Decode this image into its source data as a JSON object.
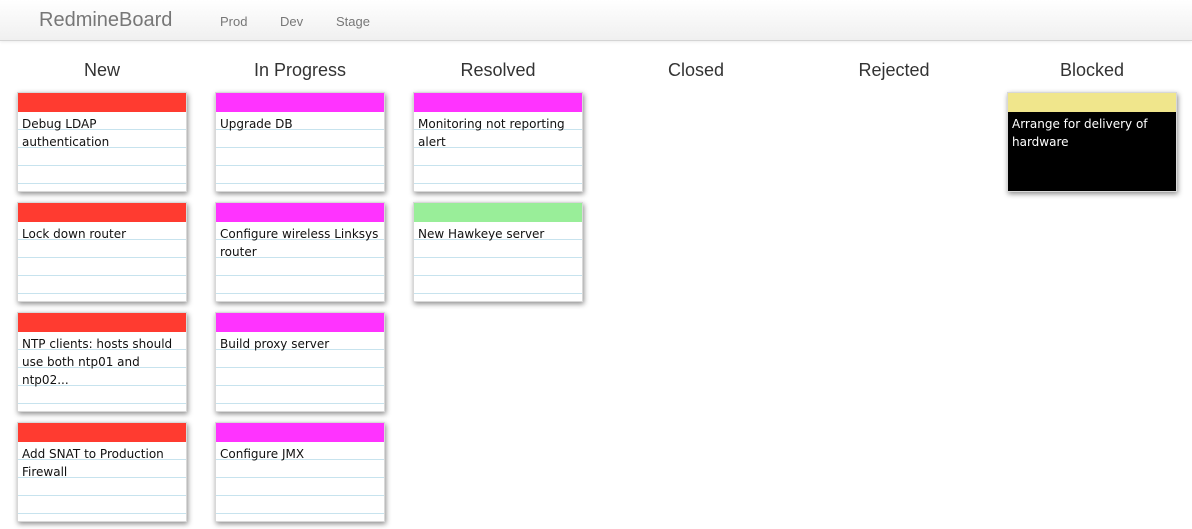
{
  "navbar": {
    "brand": "RedmineBoard",
    "links": [
      "Prod",
      "Dev",
      "Stage"
    ]
  },
  "colors": {
    "new": "#ff3b30",
    "in_progress": "#ff33ff",
    "resolved_monitoring": "#ff33ff",
    "resolved_hawkeye": "#99ee99",
    "blocked_bar": "#f0e68c",
    "blocked_body": "#000000"
  },
  "columns": [
    {
      "title": "New",
      "cards": [
        {
          "title": "Debug LDAP authentication"
        },
        {
          "title": "Lock down router"
        },
        {
          "title": "NTP clients: hosts should use both ntp01 and ntp02..."
        },
        {
          "title": "Add SNAT to Production Firewall"
        }
      ]
    },
    {
      "title": "In Progress",
      "cards": [
        {
          "title": "Upgrade DB"
        },
        {
          "title": "Configure wireless Linksys router"
        },
        {
          "title": "Build proxy server"
        },
        {
          "title": "Configure JMX"
        }
      ]
    },
    {
      "title": "Resolved",
      "cards": [
        {
          "title": "Monitoring not reporting alert"
        },
        {
          "title": "New Hawkeye server"
        }
      ]
    },
    {
      "title": "Closed",
      "cards": []
    },
    {
      "title": "Rejected",
      "cards": []
    },
    {
      "title": "Blocked",
      "cards": [
        {
          "title": "Arrange for delivery of hardware"
        }
      ]
    }
  ]
}
